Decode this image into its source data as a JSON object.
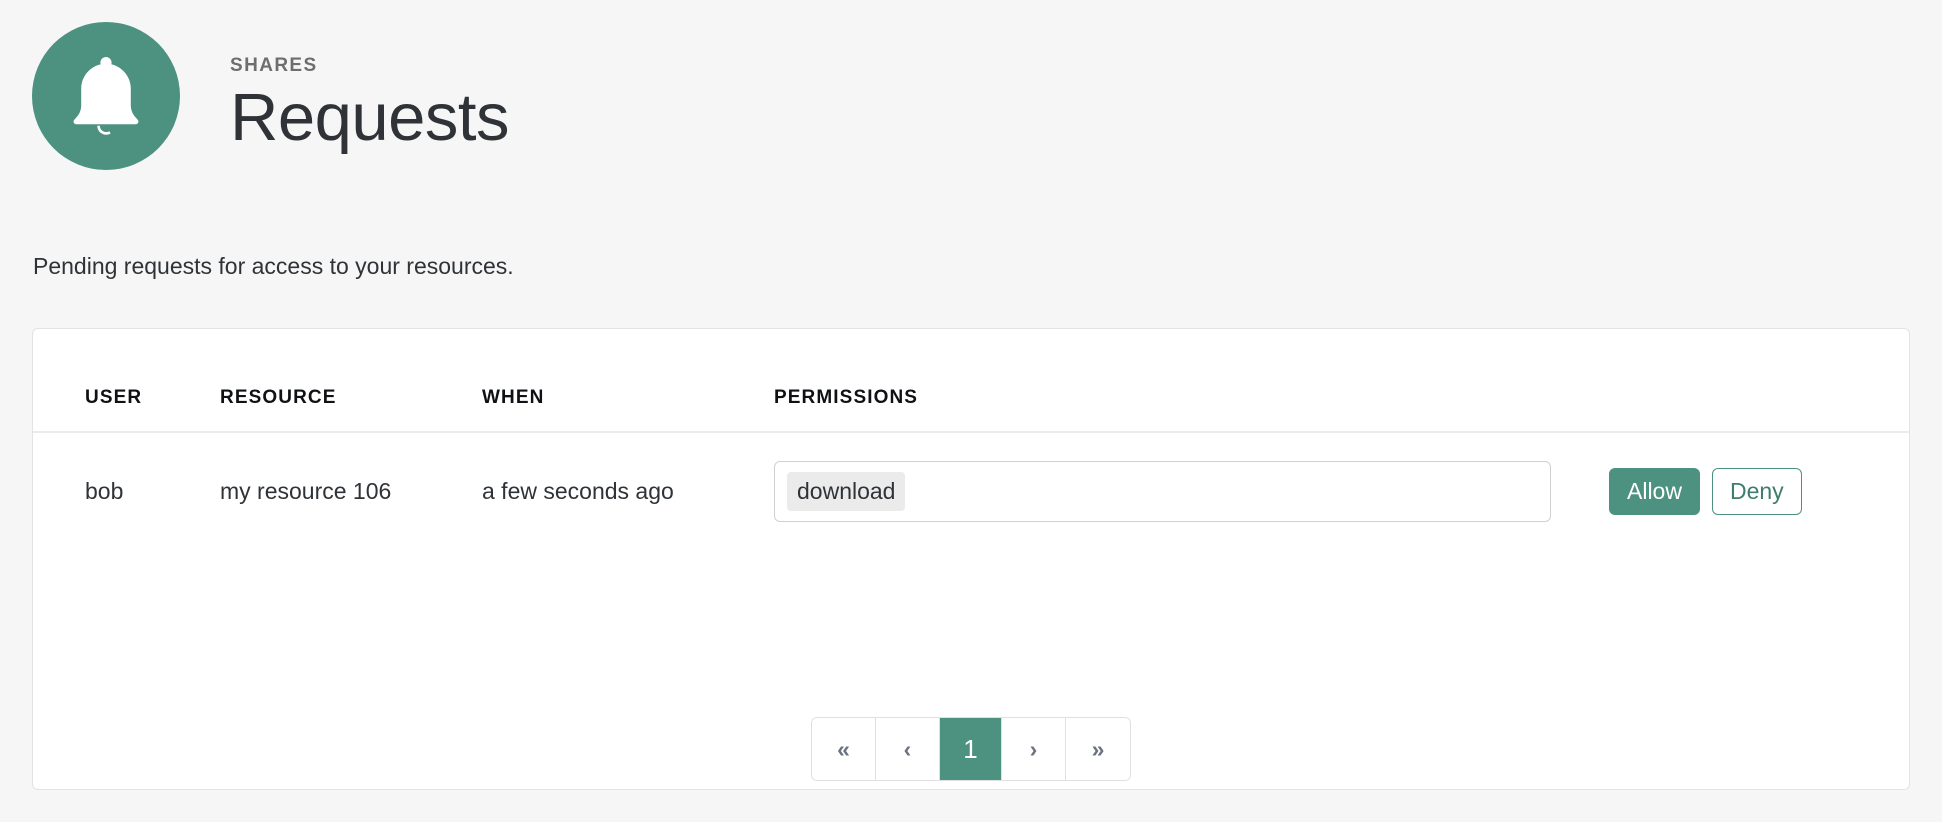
{
  "theme": {
    "accent": "#4d9180",
    "page_background": "#f6f6f6",
    "card_background": "#ffffff",
    "border": "#e3e3e3",
    "text": "#2f3337",
    "muted_text": "#6e6e6e",
    "chip_background": "#ebebeb"
  },
  "header": {
    "icon": "bell-icon",
    "eyebrow": "SHARES",
    "title": "Requests"
  },
  "subtitle": "Pending requests for access to your resources.",
  "table": {
    "columns": [
      "USER",
      "RESOURCE",
      "WHEN",
      "PERMISSIONS"
    ],
    "rows": [
      {
        "user": "bob",
        "resource": "my resource 106",
        "when": "a few seconds ago",
        "permissions": [
          "download"
        ],
        "allow_label": "Allow",
        "deny_label": "Deny"
      }
    ]
  },
  "pagination": {
    "first_label": "«",
    "prev_label": "‹",
    "pages": [
      "1"
    ],
    "active_page": "1",
    "next_label": "›",
    "last_label": "»"
  }
}
